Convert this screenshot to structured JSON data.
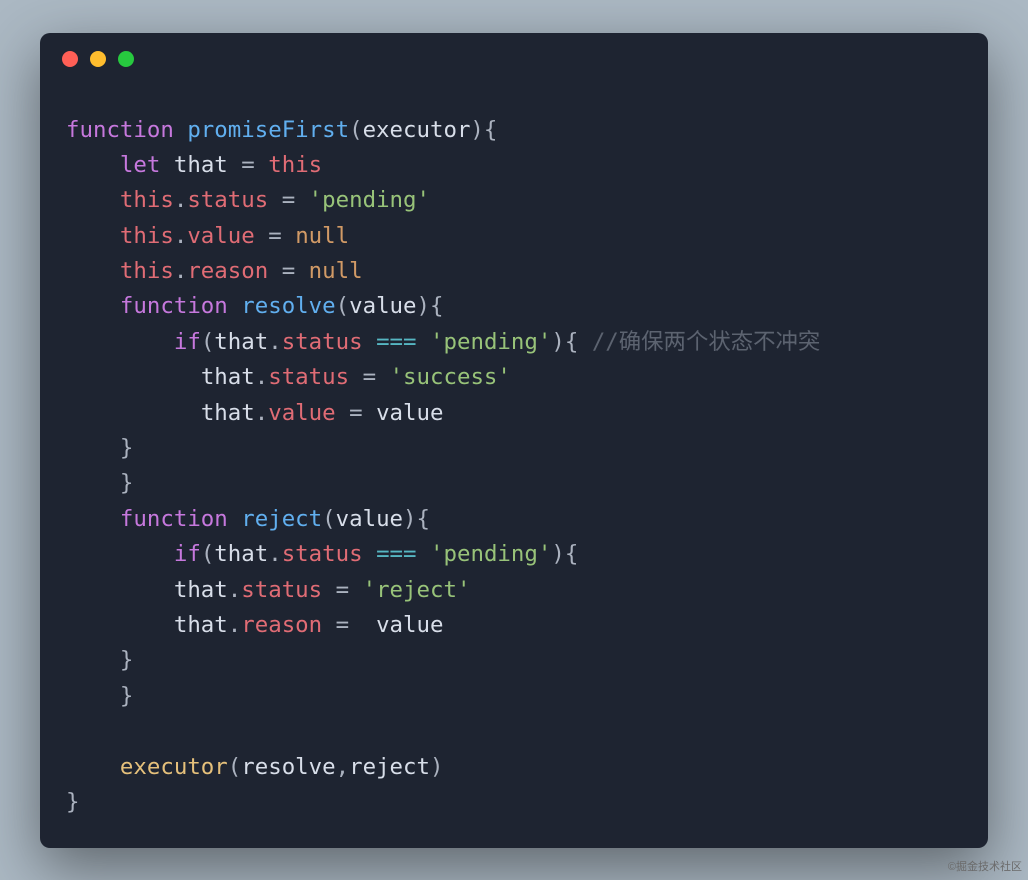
{
  "window": {
    "dots": [
      "red",
      "yellow",
      "green"
    ]
  },
  "code": {
    "l1": {
      "kw": "function",
      "sp": " ",
      "fn": "promiseFirst",
      "open": "(",
      "param": "executor",
      "close": "){"
    },
    "l2": {
      "indent": "    ",
      "let": "let",
      "sp": " ",
      "ident": "that",
      "eq": " = ",
      "this": "this"
    },
    "l3": {
      "indent": "    ",
      "this": "this",
      "dot": ".",
      "prop": "status",
      "eq": " = ",
      "q1": "'",
      "str": "pending",
      "q2": "'"
    },
    "l4": {
      "indent": "    ",
      "this": "this",
      "dot": ".",
      "prop": "value",
      "eq": " = ",
      "null": "null"
    },
    "l5": {
      "indent": "    ",
      "this": "this",
      "dot": ".",
      "prop": "reason",
      "eq": " = ",
      "null": "null"
    },
    "l6": {
      "indent": "    ",
      "kw": "function",
      "sp": " ",
      "fn": "resolve",
      "open": "(",
      "param": "value",
      "close": "){"
    },
    "l7": {
      "indent": "        ",
      "if": "if",
      "open": "(",
      "ident": "that",
      "dot": ".",
      "prop": "status",
      "sp": " ",
      "op": "===",
      "sp2": " ",
      "q1": "'",
      "str": "pending",
      "q2": "'",
      "close": "){",
      "sp3": " ",
      "comment": "//确保两个状态不冲突"
    },
    "l8": {
      "indent": "          ",
      "ident": "that",
      "dot": ".",
      "prop": "status",
      "eq": " = ",
      "q1": "'",
      "str": "success",
      "q2": "'"
    },
    "l9": {
      "indent": "          ",
      "ident": "that",
      "dot": ".",
      "prop": "value",
      "eq": " = ",
      "val": "value"
    },
    "l10": {
      "indent": "    ",
      "brace": "}"
    },
    "l11": {
      "indent": "    ",
      "brace": "}"
    },
    "l12": {
      "indent": "    ",
      "kw": "function",
      "sp": " ",
      "fn": "reject",
      "open": "(",
      "param": "value",
      "close": "){"
    },
    "l13": {
      "indent": "        ",
      "if": "if",
      "open": "(",
      "ident": "that",
      "dot": ".",
      "prop": "status",
      "sp": " ",
      "op": "===",
      "sp2": " ",
      "q1": "'",
      "str": "pending",
      "q2": "'",
      "close": "){"
    },
    "l14": {
      "indent": "        ",
      "ident": "that",
      "dot": ".",
      "prop": "status",
      "eq": " = ",
      "q1": "'",
      "str": "reject",
      "q2": "'"
    },
    "l15": {
      "indent": "        ",
      "ident": "that",
      "dot": ".",
      "prop": "reason",
      "eq": " =  ",
      "val": "value"
    },
    "l16": {
      "indent": "    ",
      "brace": "}"
    },
    "l17": {
      "indent": "    ",
      "brace": "}"
    },
    "l18": "",
    "l19": {
      "indent": "    ",
      "call": "executor",
      "open": "(",
      "a1": "resolve",
      "comma": ",",
      "a2": "reject",
      "close": ")"
    },
    "l20": {
      "brace": "}"
    }
  },
  "watermark": "©掘金技术社区"
}
